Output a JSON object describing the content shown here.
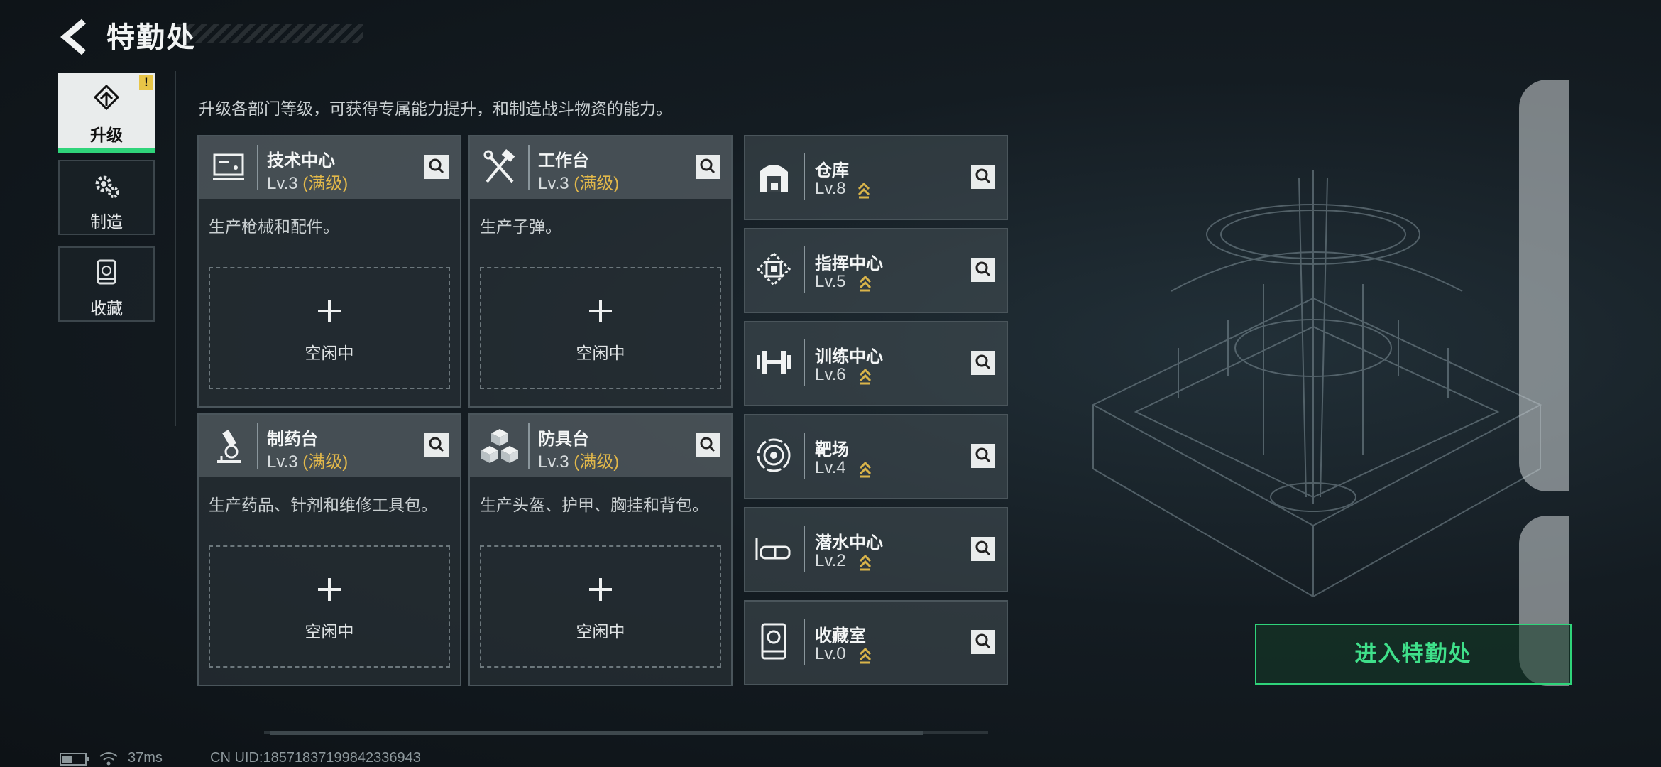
{
  "header": {
    "title": "特勤处"
  },
  "nav": [
    {
      "label": "升级",
      "icon": "upgrade-icon",
      "active": true,
      "alert": "!"
    },
    {
      "label": "制造",
      "icon": "gears-icon",
      "active": false
    },
    {
      "label": "收藏",
      "icon": "collection-icon",
      "active": false
    }
  ],
  "description": "升级各部门等级，可获得专属能力提升，和制造战斗物资的能力。",
  "departments": [
    {
      "name": "技术中心",
      "level": "Lv.3",
      "max": "(满级)",
      "desc": "生产枪械和配件。",
      "slot": "空闲中",
      "icon": "computer-icon"
    },
    {
      "name": "工作台",
      "level": "Lv.3",
      "max": "(满级)",
      "desc": "生产子弹。",
      "slot": "空闲中",
      "icon": "tools-icon"
    },
    {
      "name": "制药台",
      "level": "Lv.3",
      "max": "(满级)",
      "desc": "生产药品、针剂和维修工具包。",
      "slot": "空闲中",
      "icon": "microscope-icon"
    },
    {
      "name": "防具台",
      "level": "Lv.3",
      "max": "(满级)",
      "desc": "生产头盔、护甲、胸挂和背包。",
      "slot": "空闲中",
      "icon": "cubes-icon"
    }
  ],
  "facilities": [
    {
      "name": "仓库",
      "level": "Lv.8",
      "icon": "warehouse-icon"
    },
    {
      "name": "指挥中心",
      "level": "Lv.5",
      "icon": "chip-icon"
    },
    {
      "name": "训练中心",
      "level": "Lv.6",
      "icon": "dumbbell-icon"
    },
    {
      "name": "靶场",
      "level": "Lv.4",
      "icon": "target-icon"
    },
    {
      "name": "潜水中心",
      "level": "Lv.2",
      "icon": "goggles-icon"
    },
    {
      "name": "收藏室",
      "level": "Lv.0",
      "icon": "vault-icon"
    }
  ],
  "enter_button": "进入特勤处",
  "status": {
    "ping": "37ms",
    "uid": "CN UID:18571837199842336943"
  },
  "colors": {
    "accent": "#2fd47a",
    "max_level": "#e2b84a",
    "alert": "#e8c547"
  }
}
